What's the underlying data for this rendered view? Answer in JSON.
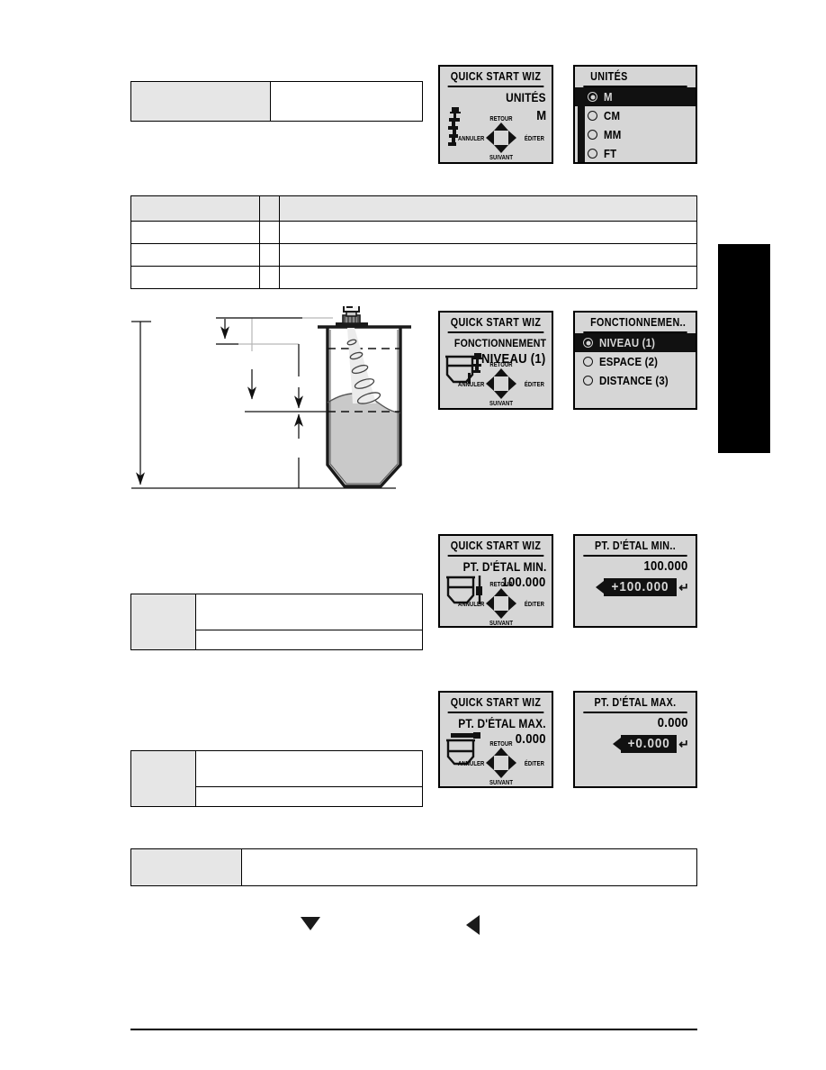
{
  "page": {
    "language": "fr",
    "background": "#ffffff",
    "edge_tab_color": "#000000"
  },
  "tables": [
    {
      "id": "table-units",
      "rows": 1,
      "columns": 2,
      "header_shaded_cell": "left",
      "cells_blank": true
    },
    {
      "id": "table-operation",
      "rows": 4,
      "columns": 3,
      "header_row_shaded": true,
      "cells_blank": true
    },
    {
      "id": "table-span-min",
      "rows": 2,
      "columns": 2,
      "shaded_column": "left",
      "cells_blank": true
    },
    {
      "id": "table-span-max",
      "rows": 2,
      "columns": 2,
      "shaded_column": "left",
      "cells_blank": true
    },
    {
      "id": "table-note",
      "rows": 1,
      "columns": 2,
      "shaded_column": "left",
      "cells_blank": true
    }
  ],
  "nav_labels": {
    "up": "RETOUR",
    "down": "SUIVANT",
    "left": "ANNULER",
    "right": "ÉDITER"
  },
  "wizard_title": "QUICK START WIZ",
  "panels": [
    {
      "id": "units",
      "wizard": {
        "title": "QUICK START WIZ",
        "param": "UNITÉS",
        "value": "M",
        "icon": "transmitter-icon"
      },
      "list": {
        "title": "UNITÉS",
        "options": [
          {
            "label": "M",
            "selected": true
          },
          {
            "label": "CM",
            "selected": false
          },
          {
            "label": "MM",
            "selected": false
          },
          {
            "label": "FT",
            "selected": false
          }
        ],
        "scrollbar": true
      }
    },
    {
      "id": "operation",
      "wizard": {
        "title": "QUICK START WIZ",
        "param": "FONCTIONNEMENT",
        "value": "NIVEAU (1)",
        "icon": "vessel-level-icon"
      },
      "list": {
        "title": "FONCTIONNEMEN..",
        "options": [
          {
            "label": "NIVEAU (1)",
            "selected": true
          },
          {
            "label": "ESPACE (2)",
            "selected": false
          },
          {
            "label": "DISTANCE (3)",
            "selected": false
          }
        ],
        "scrollbar": false
      }
    },
    {
      "id": "span-min",
      "wizard": {
        "title": "QUICK START WIZ",
        "param": "PT. D'ÉTAL MIN.",
        "value": "100.000",
        "icon": "vessel-min-icon"
      },
      "editor": {
        "title": "PT. D'ÉTAL MIN..",
        "display_value": "100.000",
        "edit_value": "+100.000",
        "has_left_arrow": true,
        "has_enter_arrow": true
      }
    },
    {
      "id": "span-max",
      "wizard": {
        "title": "QUICK START WIZ",
        "param": "PT. D'ÉTAL MAX.",
        "value": "0.000",
        "icon": "vessel-max-icon"
      },
      "editor": {
        "title": "PT. D'ÉTAL MAX.",
        "display_value": "0.000",
        "edit_value": "+0.000",
        "has_left_arrow": true,
        "has_enter_arrow": true
      }
    }
  ],
  "diagram": {
    "id": "vessel-level-measurement-diagram",
    "elements": [
      "radar-level-transmitter",
      "ultrasonic-beam-cone",
      "vessel-outline",
      "material-fill",
      "material-surface-dashed-line",
      "reference-dashed-line",
      "dimension-lines"
    ],
    "fill_color": "#c9c9c9"
  },
  "glyphs": [
    {
      "name": "down-arrow-glyph",
      "direction": "down"
    },
    {
      "name": "left-arrow-glyph",
      "direction": "left"
    }
  ]
}
